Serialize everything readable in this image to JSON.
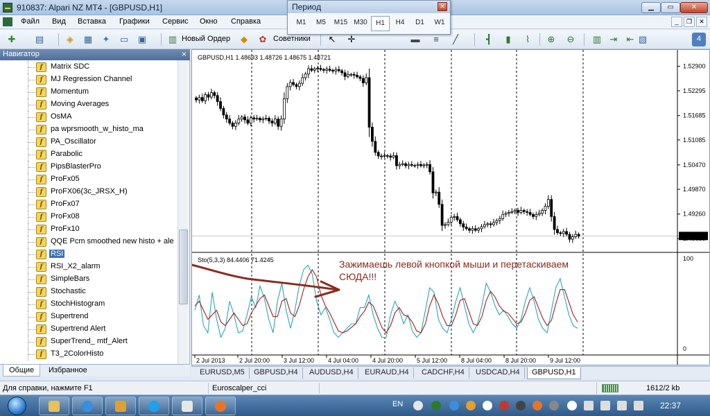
{
  "window": {
    "title": "910837: Alpari NZ MT4 - [GBPUSD,H1]"
  },
  "menu": {
    "items": [
      "Файл",
      "Вид",
      "Вставка",
      "Графики",
      "Сервис",
      "Окно",
      "Справка"
    ]
  },
  "toolbar": {
    "new_order": "Новый Ордер",
    "experts": "Советники"
  },
  "period": {
    "title": "Период",
    "buttons": [
      "M1",
      "M5",
      "M15",
      "M30",
      "H1",
      "H4",
      "D1",
      "W1"
    ],
    "active": "H1"
  },
  "navigator": {
    "title": "Навигатор",
    "items": [
      "Matrix SDC",
      "MJ Regression Channel",
      "Momentum",
      "Moving Averages",
      "OsMA",
      "pa wprsmooth_w_histo_ma",
      "PA_Oscillator",
      "Parabolic",
      "PipsBlasterPro",
      "ProFx05",
      "ProFX06(3c_JRSX_H)",
      "ProFx07",
      "ProFx08",
      "ProFx10",
      "QQE Pcm smoothed new histo + ale",
      "RSI",
      "RSI_X2_alarm",
      "SimpleBars",
      "Stochastic",
      "StochHistogram",
      "Supertrend",
      "Supertrend  Alert",
      "SuperTrend_ mtf_Alert",
      "T3_2ColorHisto"
    ],
    "selected": "RSI",
    "tabs": [
      "Общие",
      "Избранное"
    ],
    "active_tab": "Общие"
  },
  "chart": {
    "header": "GBPUSD,H1  1.48693 1.48726 1.48675 1.48721",
    "current_price": "1.48721",
    "price_ticks": [
      "1.52900",
      "1.52295",
      "1.51685",
      "1.51085",
      "1.50470",
      "1.49870",
      "1.49260",
      "1.48655"
    ],
    "stoch_header": "Sto(5,3,3) 84.4406 71.4245",
    "stoch_ticks": [
      "100",
      "0"
    ],
    "time_ticks": [
      "2 Jul 2013",
      "2 Jul 20:00",
      "3 Jul 12:00",
      "4 Jul 04:00",
      "4 Jul 20:00",
      "5 Jul 12:00",
      "8 Jul 04:00",
      "8 Jul 20:00",
      "9 Jul 12:00"
    ],
    "annotation": "Зажимаешь левой кнопкой мыши и перетаскиваем СЮДА!!!",
    "colors": {
      "annotation": "#8b2a1e",
      "main_line": "#2aa6b8",
      "signal_line": "#a0201a"
    }
  },
  "chart_data": {
    "type": "line",
    "title": "GBPUSD,H1",
    "ylim": [
      1.4835,
      1.532
    ],
    "close": [
      1.5207,
      1.5213,
      1.5205,
      1.522,
      1.5214,
      1.5225,
      1.5218,
      1.5203,
      1.5186,
      1.517,
      1.516,
      1.515,
      1.5142,
      1.515,
      1.516,
      1.5165,
      1.5158,
      1.515,
      1.5163,
      1.516,
      1.5162,
      1.5158,
      1.516,
      1.5162,
      1.5155,
      1.515,
      1.516,
      1.5142,
      1.516,
      1.521,
      1.524,
      1.525,
      1.5245,
      1.524,
      1.5248,
      1.5262,
      1.5271,
      1.5284,
      1.528,
      1.5284,
      1.5285,
      1.5282,
      1.528,
      1.5283,
      1.528,
      1.5278,
      1.5282,
      1.5279,
      1.5274,
      1.5265,
      1.527,
      1.527,
      1.5268,
      1.5264,
      1.526,
      1.5249,
      1.5262,
      1.514,
      1.5105,
      1.5078,
      1.5069,
      1.5068,
      1.507,
      1.5069,
      1.5066,
      1.507,
      1.5045,
      1.5048,
      1.505,
      1.5045,
      1.5048,
      1.5046,
      1.5046,
      1.5048,
      1.5045,
      1.5047,
      1.5048,
      1.503,
      1.4978,
      1.498,
      1.495,
      1.4898,
      1.49,
      1.4906,
      1.4918,
      1.492,
      1.4912,
      1.4902,
      1.4894,
      1.489,
      1.4886,
      1.489,
      1.4886,
      1.489,
      1.4895,
      1.49,
      1.4902,
      1.49,
      1.4905,
      1.491,
      1.4915,
      1.4925,
      1.4928,
      1.493,
      1.4932,
      1.4935,
      1.493,
      1.4935,
      1.4932,
      1.493,
      1.4925,
      1.492,
      1.4925,
      1.4928,
      1.4935,
      1.4945,
      1.4962,
      1.492,
      1.4888,
      1.488,
      1.4878,
      1.4883,
      1.4876,
      1.4864,
      1.487,
      1.4876,
      1.4872
    ],
    "stoch_main": [
      45,
      62,
      28,
      20,
      65,
      35,
      15,
      25,
      55,
      40,
      20,
      22,
      40,
      60,
      48,
      72,
      58,
      35,
      20,
      55,
      75,
      45,
      25,
      45,
      72,
      90,
      95,
      85,
      55,
      40,
      48,
      35,
      20,
      15,
      20,
      25,
      30,
      30,
      48,
      48,
      62,
      40,
      25,
      15,
      15,
      40,
      55,
      45,
      30,
      40,
      22,
      15,
      20,
      45,
      70,
      65,
      35,
      25,
      20,
      35,
      55,
      70,
      50,
      30,
      20,
      30,
      50,
      75,
      65,
      50,
      40,
      45,
      38,
      30,
      25,
      35,
      55,
      70,
      55,
      35,
      25,
      20,
      45,
      70,
      80,
      60,
      40,
      28,
      25
    ],
    "stoch_signal": [
      50,
      55,
      45,
      35,
      40,
      45,
      32,
      28,
      35,
      42,
      35,
      28,
      30,
      42,
      50,
      58,
      62,
      50,
      38,
      38,
      55,
      58,
      42,
      38,
      50,
      68,
      82,
      90,
      82,
      62,
      50,
      42,
      32,
      22,
      20,
      22,
      26,
      30,
      38,
      44,
      54,
      50,
      38,
      26,
      20,
      28,
      42,
      48,
      40,
      38,
      32,
      22,
      20,
      30,
      50,
      62,
      52,
      38,
      28,
      28,
      40,
      56,
      58,
      44,
      30,
      28,
      38,
      56,
      66,
      60,
      50,
      44,
      42,
      36,
      30,
      32,
      42,
      56,
      60,
      48,
      36,
      28,
      34,
      52,
      68,
      68,
      54,
      40,
      32
    ]
  }
}
